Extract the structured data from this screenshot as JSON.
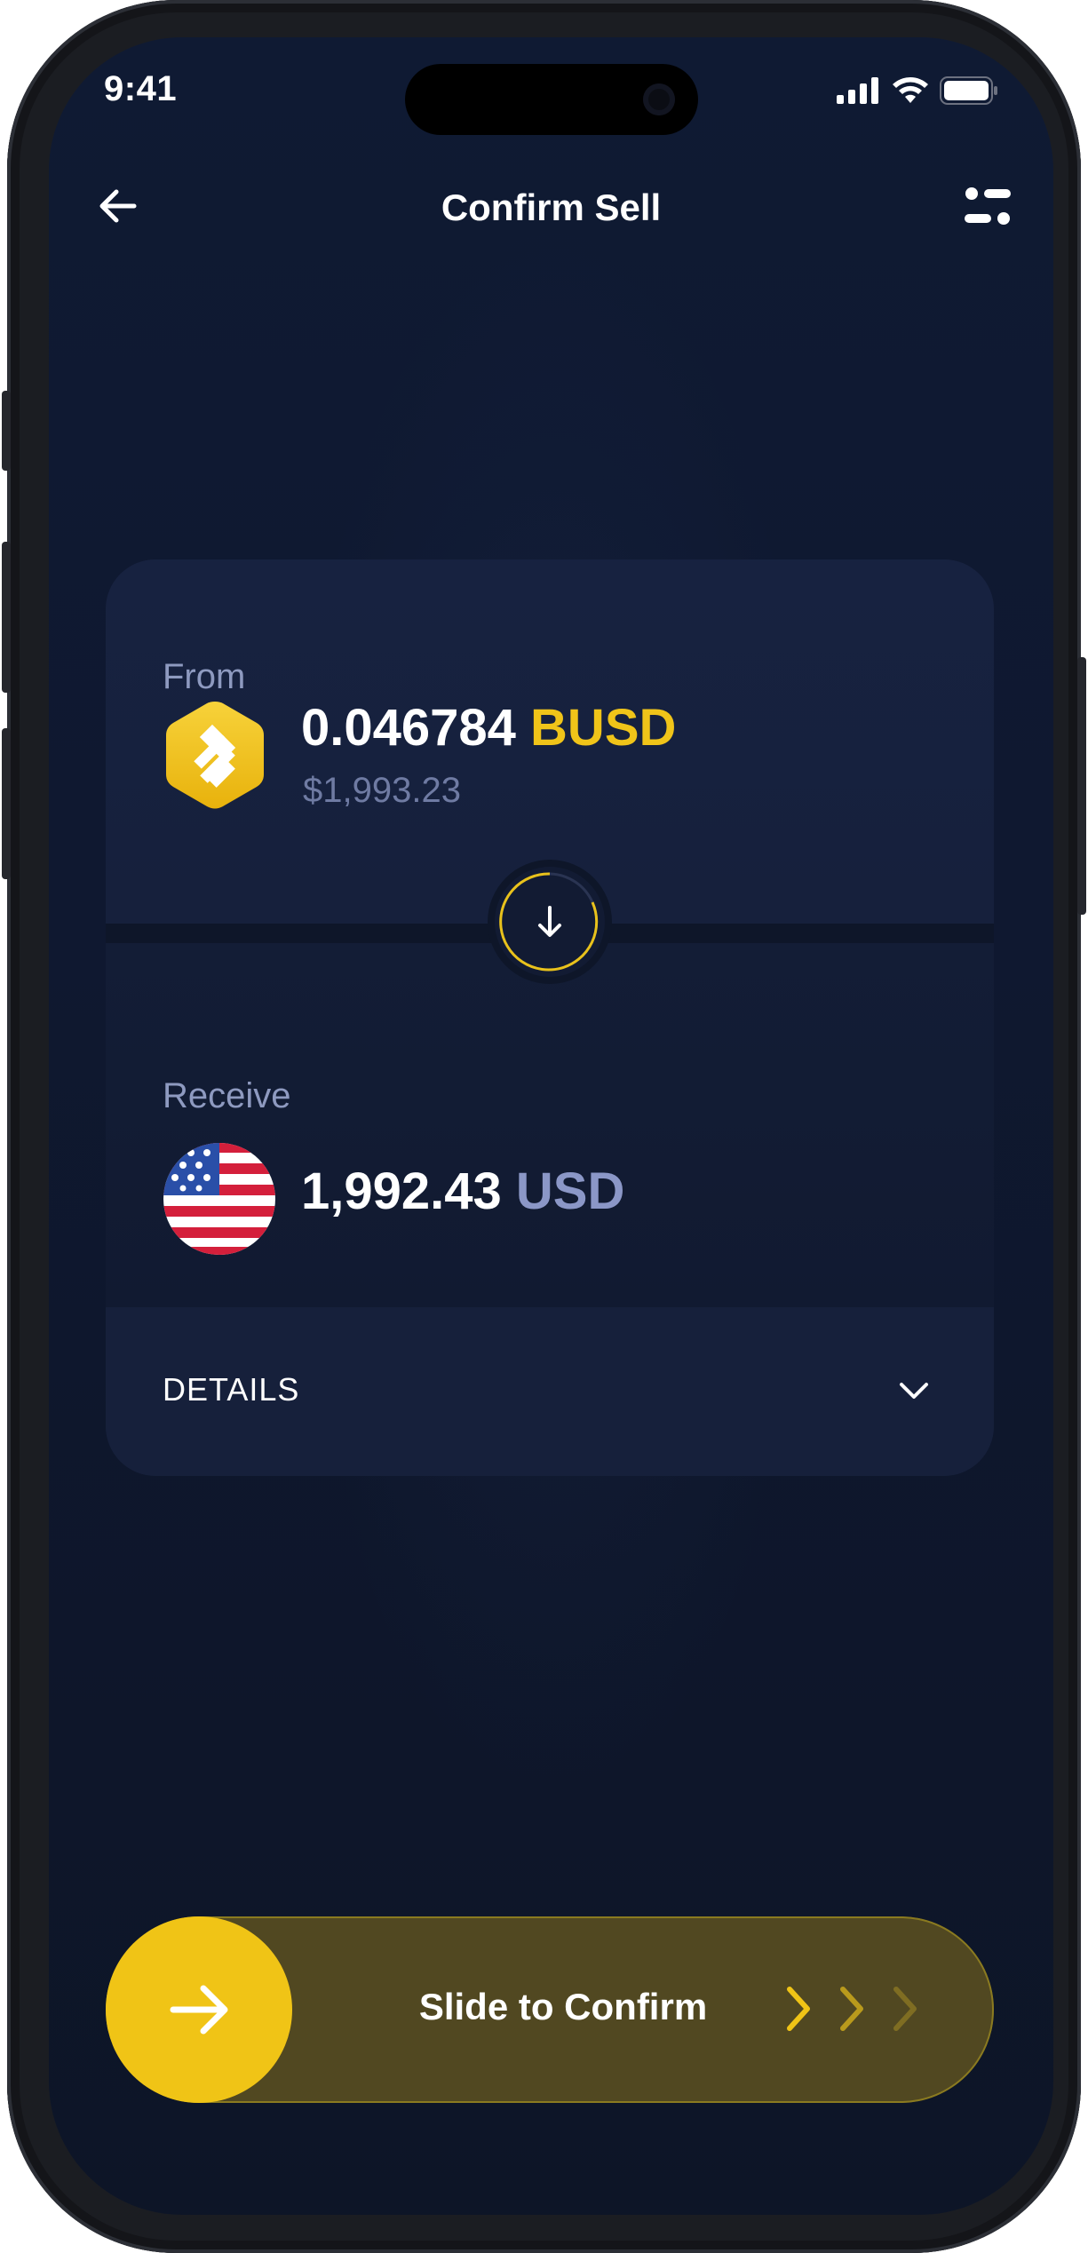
{
  "status_bar": {
    "time": "9:41"
  },
  "header": {
    "title": "Confirm Sell"
  },
  "from": {
    "label": "From",
    "amount": "0.046784",
    "currency": "BUSD",
    "fiat_value": "$1,993.23"
  },
  "receive": {
    "label": "Receive",
    "amount": "1,992.43",
    "currency": "USD"
  },
  "details": {
    "label": "DETAILS"
  },
  "slider": {
    "label": "Slide to Confirm"
  },
  "colors": {
    "accent": "#f0c416",
    "background": "#0f1a33",
    "card": "#16213b",
    "muted_text": "#8e9ac0"
  },
  "icons": {
    "back": "arrow-left-icon",
    "filter": "filter-icon",
    "coin": "busd-icon",
    "flag": "us-flag-icon",
    "swap": "arrow-down-icon",
    "expand": "chevron-down-icon",
    "confirm": "arrow-right-icon"
  }
}
